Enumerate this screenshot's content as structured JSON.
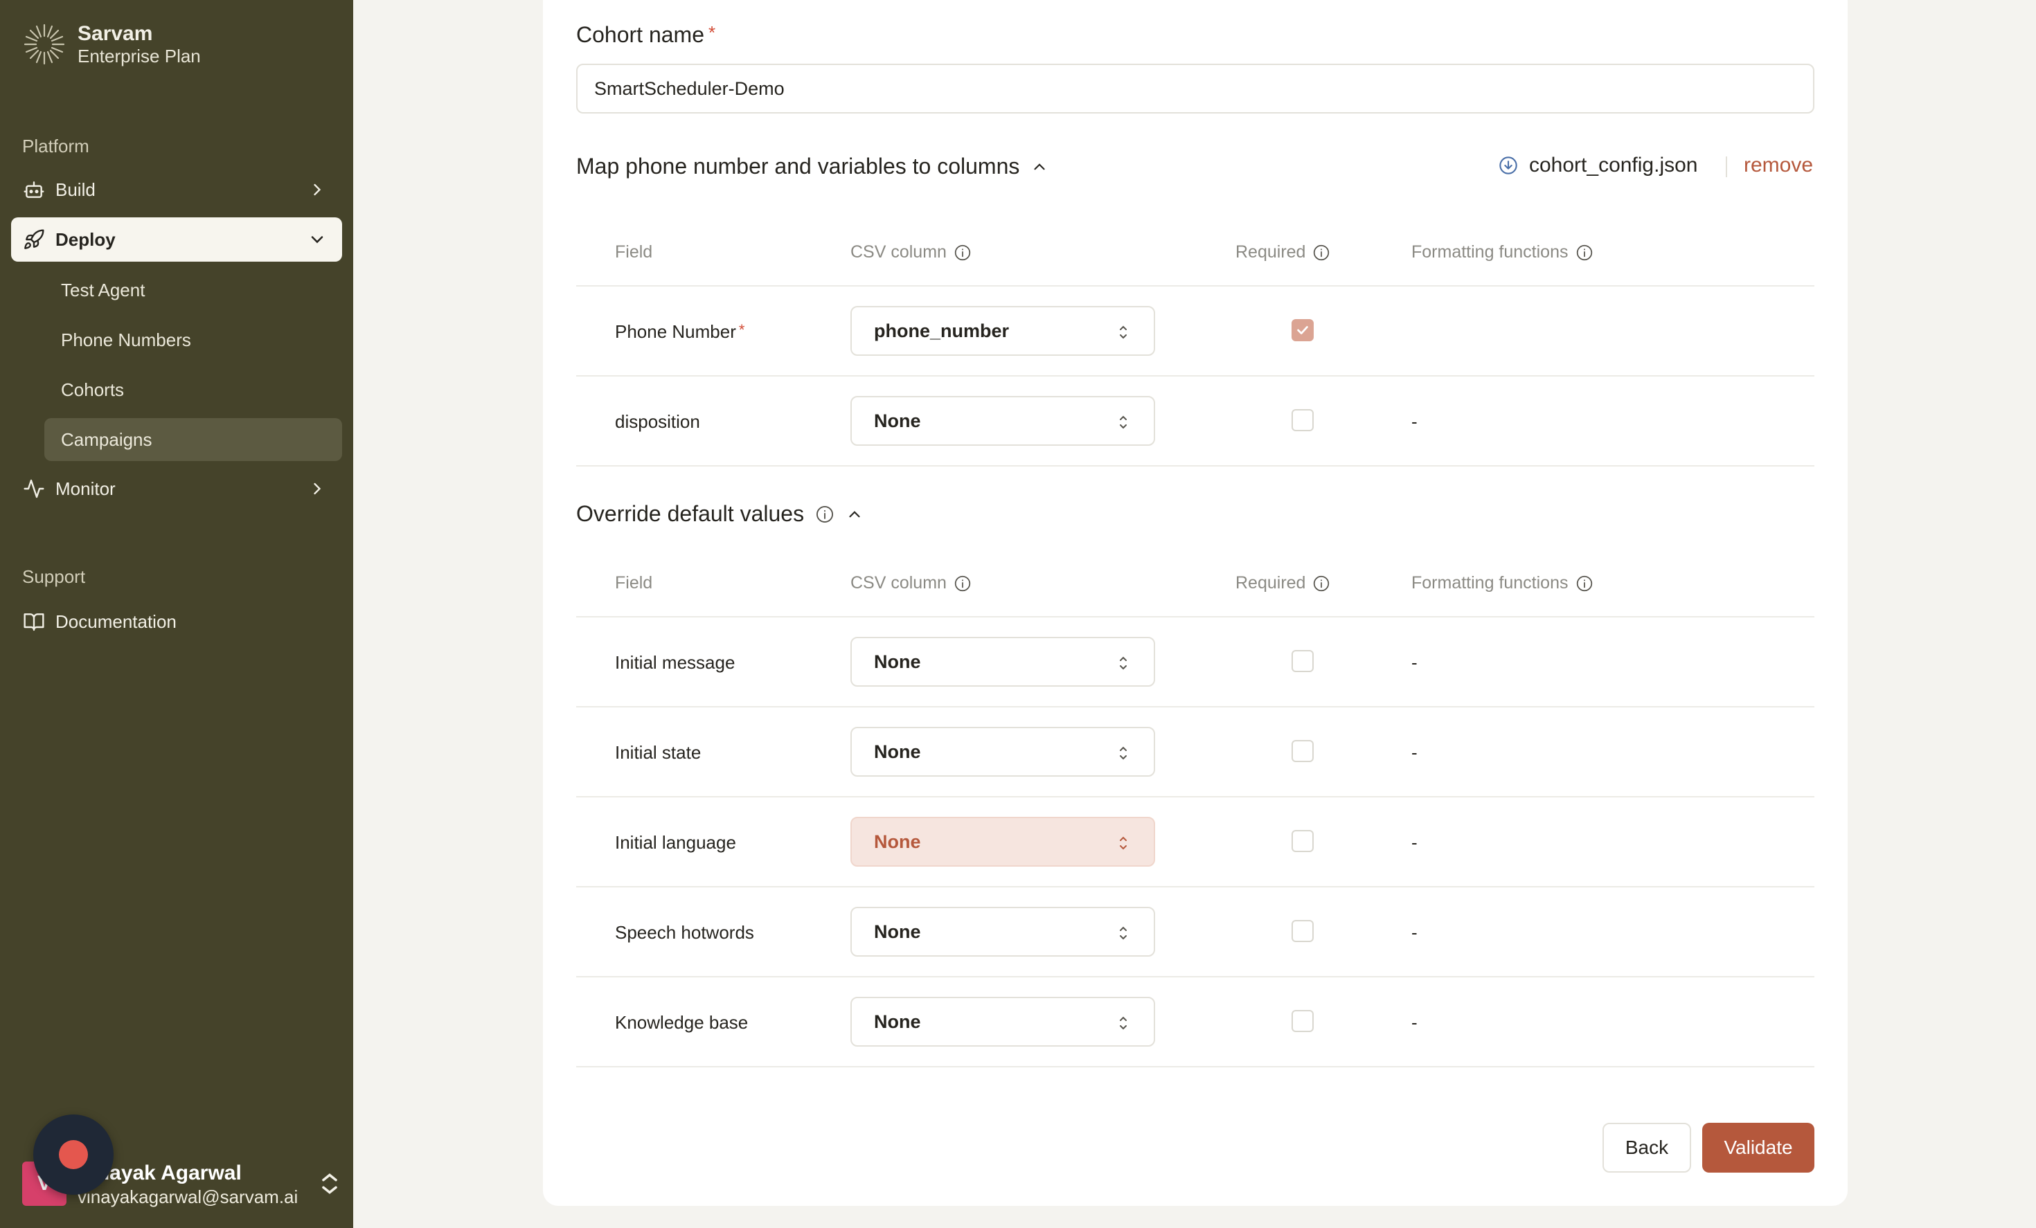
{
  "sidebar": {
    "brand": {
      "name": "Sarvam",
      "plan": "Enterprise Plan"
    },
    "platform_label": "Platform",
    "nav": {
      "build": "Build",
      "deploy": "Deploy",
      "monitor": "Monitor"
    },
    "deploy_items": [
      "Test Agent",
      "Phone Numbers",
      "Cohorts",
      "Campaigns"
    ],
    "support_label": "Support",
    "documentation": "Documentation",
    "user": {
      "initial": "V",
      "name": "Vinayak Agarwal",
      "email": "vinayakagarwal@sarvam.ai"
    }
  },
  "form": {
    "cohort_name_label": "Cohort name",
    "required_marker": "*",
    "cohort_name_value": "SmartScheduler-Demo",
    "mapping_section_title": "Map phone number and variables to columns",
    "config_file": "cohort_config.json",
    "remove_label": "remove",
    "columns": {
      "field": "Field",
      "csv_column": "CSV column",
      "required": "Required",
      "formatting": "Formatting functions"
    },
    "mapping_rows": [
      {
        "field": "Phone Number",
        "csv": "phone_number",
        "required": true,
        "formatting": ""
      },
      {
        "field": "disposition",
        "csv": "None",
        "required": false,
        "formatting": "-"
      }
    ],
    "override_section_title": "Override default values",
    "override_rows": [
      {
        "field": "Initial message",
        "csv": "None",
        "required": false,
        "formatting": "-"
      },
      {
        "field": "Initial state",
        "csv": "None",
        "required": false,
        "formatting": "-"
      },
      {
        "field": "Initial language",
        "csv": "None",
        "required": false,
        "formatting": "-",
        "highlighted": true
      },
      {
        "field": "Speech hotwords",
        "csv": "None",
        "required": false,
        "formatting": "-"
      },
      {
        "field": "Knowledge base",
        "csv": "None",
        "required": false,
        "formatting": "-"
      }
    ],
    "back_label": "Back",
    "validate_label": "Validate"
  },
  "colors": {
    "sidebar_bg": "#45432a",
    "accent": "#b5583c",
    "avatar": "#d6406a",
    "record_dot": "#e4574e"
  },
  "icons": [
    "sarvam-logo-icon",
    "build-icon",
    "deploy-rocket-icon",
    "monitor-activity-icon",
    "documentation-book-icon",
    "chevron-right-icon",
    "chevron-down-icon",
    "chevron-up-icon",
    "info-icon",
    "download-icon",
    "select-updown-icon",
    "checkmark-icon",
    "record-icon"
  ]
}
